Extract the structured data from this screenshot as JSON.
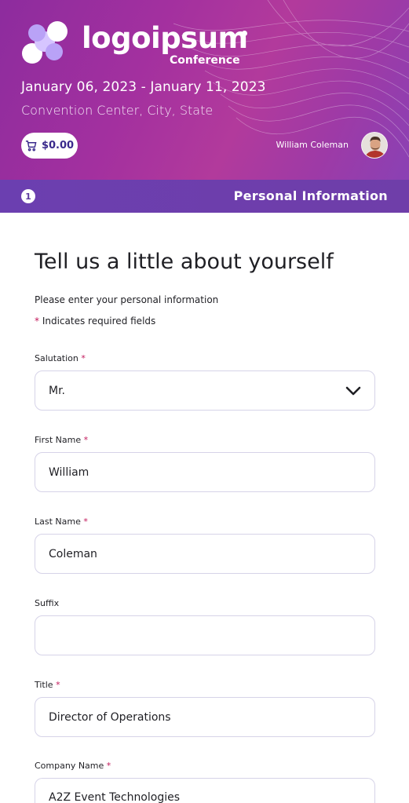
{
  "header": {
    "logo_text": "logoipsum",
    "logo_subtitle": "Conference",
    "dates": "January 06, 2023 - January 11, 2023",
    "venue": "Convention Center, City, State",
    "cart_total": "$0.00",
    "user_name": "William Coleman",
    "colors": {
      "gradient_start": "#8d2c9e",
      "gradient_end": "#8a41b4"
    }
  },
  "step": {
    "number": "1",
    "title": "Personal Information"
  },
  "form": {
    "heading": "Tell us a little about yourself",
    "intro": "Please enter your personal information",
    "required_star": "*",
    "required_note": "Indicates required fields",
    "fields": [
      {
        "label": "Salutation",
        "required": true,
        "value": "Mr.",
        "type": "select"
      },
      {
        "label": "First Name",
        "required": true,
        "value": "William",
        "type": "text"
      },
      {
        "label": "Last Name",
        "required": true,
        "value": "Coleman",
        "type": "text"
      },
      {
        "label": "Suffix",
        "required": false,
        "value": "",
        "type": "text"
      },
      {
        "label": "Title",
        "required": true,
        "value": "Director of Operations",
        "type": "text"
      },
      {
        "label": "Company Name",
        "required": true,
        "value": "A2Z Event Technologies",
        "type": "text"
      }
    ]
  },
  "icons": {
    "cart": "cart-icon",
    "dropdown": "chevron-down-icon"
  }
}
